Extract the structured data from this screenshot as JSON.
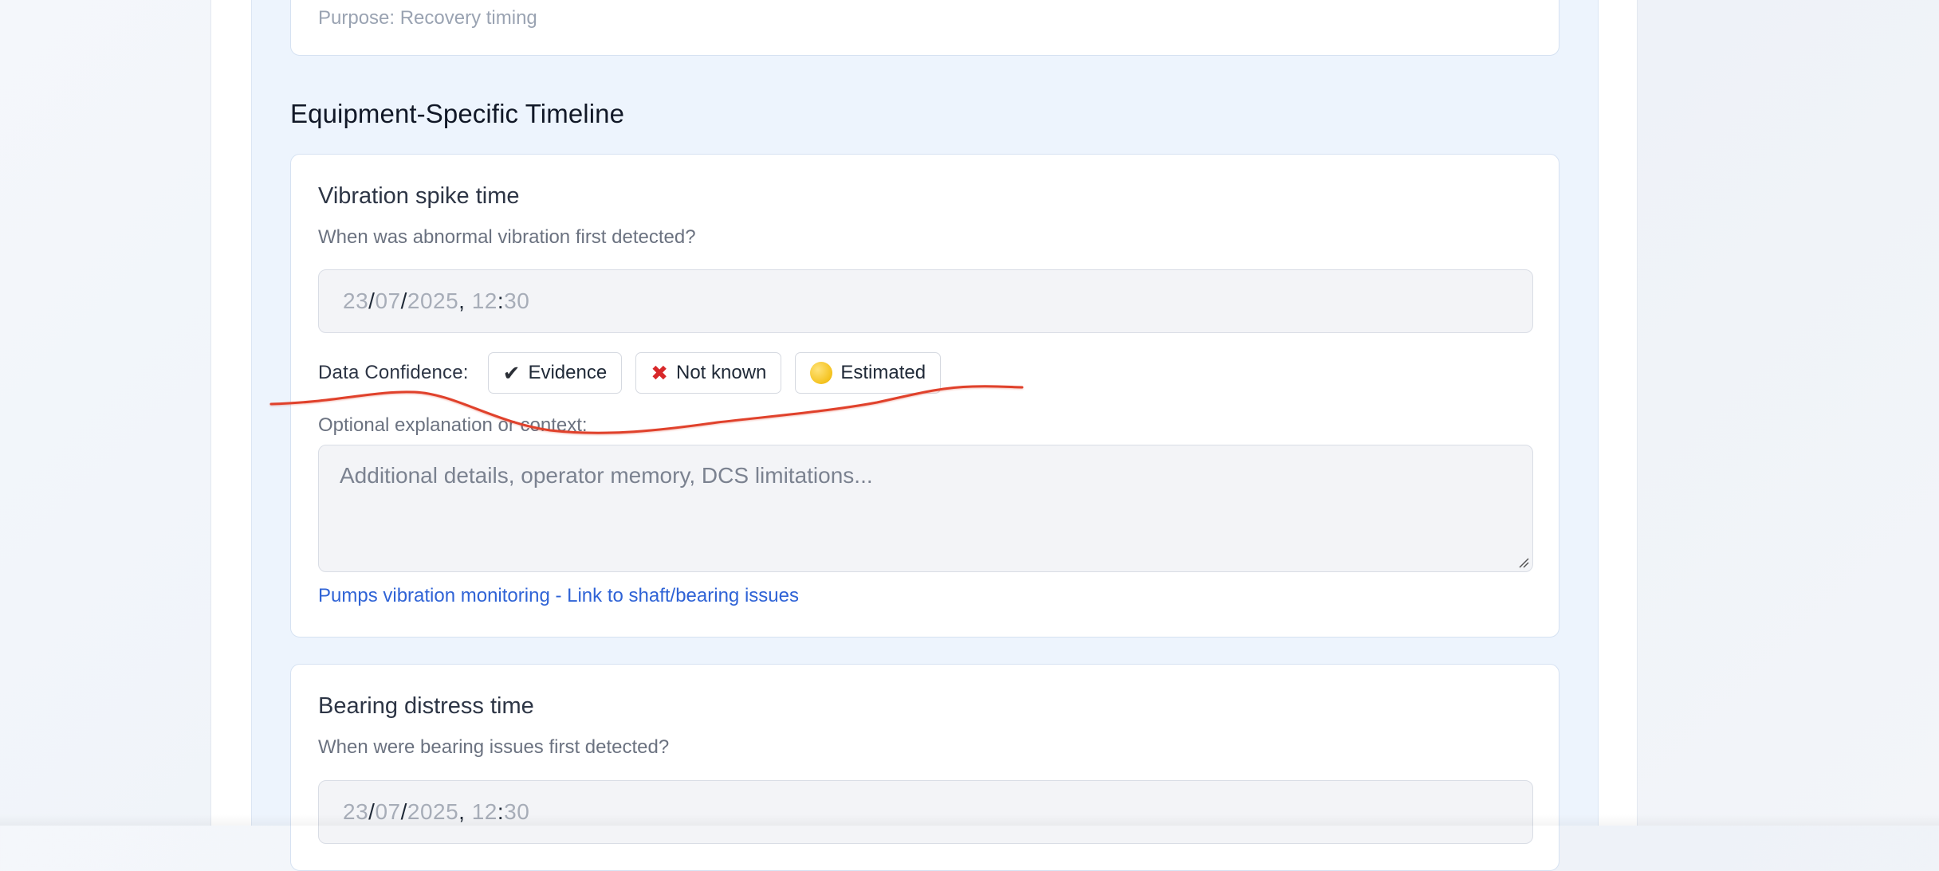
{
  "top_card": {
    "purpose": "Purpose: Recovery timing"
  },
  "section": {
    "title": "Equipment-Specific Timeline"
  },
  "cards": [
    {
      "title": "Vibration spike time",
      "question": "When was abnormal vibration first detected?",
      "datetime": {
        "day": "23",
        "month": "07",
        "year": "2025",
        "hour": "12",
        "minute": "30"
      },
      "confidence_label": "Data Confidence:",
      "confidence_options": [
        {
          "icon": "check-icon",
          "label": "Evidence"
        },
        {
          "icon": "red-x-icon",
          "label": "Not known"
        },
        {
          "icon": "yellow-circle-icon",
          "label": "Estimated"
        }
      ],
      "explanation_label": "Optional explanation or context:",
      "explanation_placeholder": "Additional details, operator memory, DCS limitations...",
      "link": "Pumps vibration monitoring - Link to shaft/bearing issues"
    },
    {
      "title": "Bearing distress time",
      "question": "When were bearing issues first detected?",
      "datetime": {
        "day": "23",
        "month": "07",
        "year": "2025",
        "hour": "12",
        "minute": "30"
      }
    }
  ],
  "colors": {
    "accent_link": "#2f63d6",
    "section_bg": "#edf4fd",
    "annotation_stroke": "#e0412b"
  }
}
